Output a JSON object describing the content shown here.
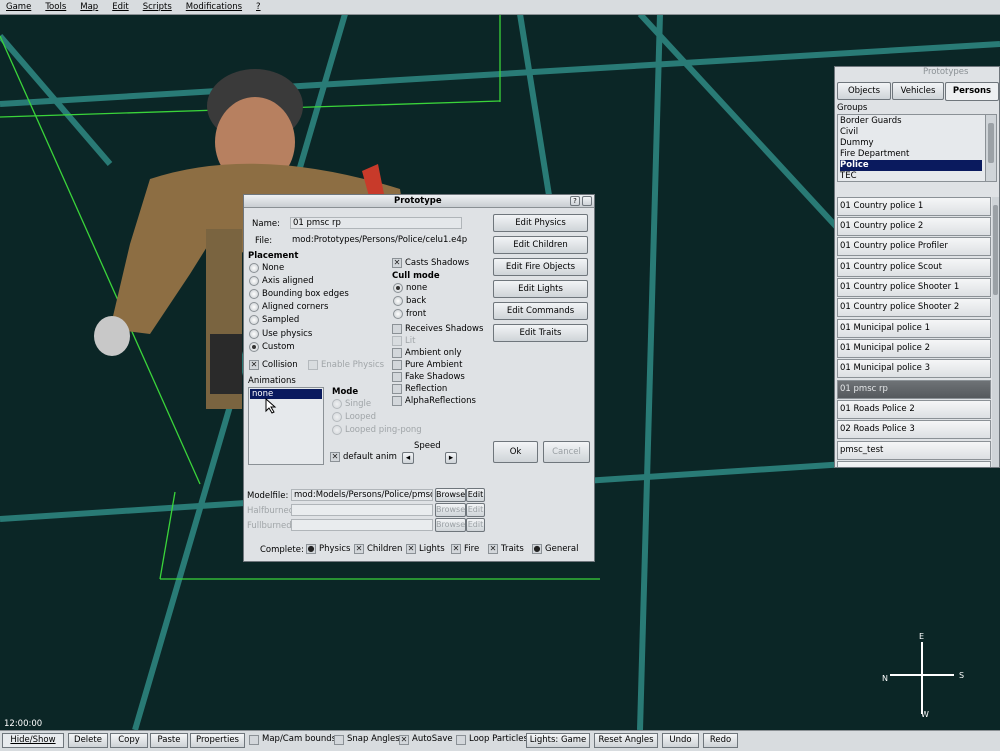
{
  "menubar": [
    "Game",
    "Tools",
    "Map",
    "Edit",
    "Scripts",
    "Modifications",
    "?"
  ],
  "clock": "12:00:00",
  "compass": {
    "n": "N",
    "s": "S",
    "e": "E",
    "w": "W"
  },
  "dialog": {
    "title": "Prototype",
    "help_glyph": "?",
    "name_label": "Name:",
    "name_value": "01 pmsc rp",
    "file_label": "File:",
    "file_value": "mod:Prototypes/Persons/Police/celu1.e4p",
    "placement_title": "Placement",
    "placement_options": [
      "None",
      "Axis aligned",
      "Bounding box edges",
      "Aligned corners",
      "Sampled",
      "Use physics",
      "Custom"
    ],
    "collision_label": "Collision",
    "enable_physics_label": "Enable Physics",
    "casts_shadows_label": "Casts Shadows",
    "cull_mode_title": "Cull mode",
    "cull_options": [
      "none",
      "back",
      "front"
    ],
    "flags": [
      "Receives Shadows",
      "Lit",
      "Ambient only",
      "Pure Ambient",
      "Fake Shadows",
      "Reflection",
      "AlphaReflections"
    ],
    "animations_title": "Animations",
    "animation_selected": "none",
    "mode_title": "Mode",
    "mode_options": [
      "Single",
      "Looped",
      "Looped ping-pong"
    ],
    "default_anim_label": "default anim",
    "speed_label": "Speed",
    "edit_buttons": [
      "Edit Physics",
      "Edit Children",
      "Edit Fire Objects",
      "Edit Lights",
      "Edit Commands",
      "Edit Traits"
    ],
    "ok_label": "Ok",
    "cancel_label": "Cancel",
    "modelfile_label": "Modelfile:",
    "modelfile_value": "mod:Models/Persons/Police/pmsc rp/",
    "halfburned_label": "Halfburned:",
    "fullburned_label": "Fullburned:",
    "browse_label": "Browse",
    "edit_label": "Edit",
    "complete_label": "Complete:",
    "complete_items": [
      "Physics",
      "Children",
      "Lights",
      "Fire",
      "Traits",
      "General"
    ]
  },
  "prototypes_panel": {
    "title": "Prototypes",
    "tabs": [
      "Objects",
      "Vehicles",
      "Persons"
    ],
    "groups_label": "Groups",
    "groups": [
      "Border Guards",
      "Civil",
      "Dummy",
      "Fire Department",
      "Police",
      "TEC"
    ],
    "selected_group": "Police",
    "items": [
      "01 Country police 1",
      "01 Country police 2",
      "01 Country police Profiler",
      "01 Country police Scout",
      "01 Country police Shooter 1",
      "01 Country police Shooter 2",
      "01 Municipal police 1",
      "01 Municipal police 2",
      "01 Municipal police 3",
      "01 pmsc rp",
      "01 Roads Police 2",
      "02 Roads Police 3",
      "pmsc_test"
    ],
    "selected_item": "01 pmsc rp"
  },
  "bottombar": {
    "hide_show": "Hide/Show",
    "delete": "Delete",
    "copy": "Copy",
    "paste": "Paste",
    "properties": "Properties",
    "map_cam_bounds": "Map/Cam bounds",
    "snap_angles": "Snap Angles",
    "autosave": "AutoSave",
    "loop_particles": "Loop Particles",
    "lights_game": "Lights: Game",
    "reset_angles": "Reset Angles",
    "undo": "Undo",
    "redo": "Redo"
  },
  "colors": {
    "grid": "#2e8c86",
    "selection_box": "#38d038",
    "selected_group_bg": "#0a1a5e",
    "sky": "#0c2a2a"
  }
}
